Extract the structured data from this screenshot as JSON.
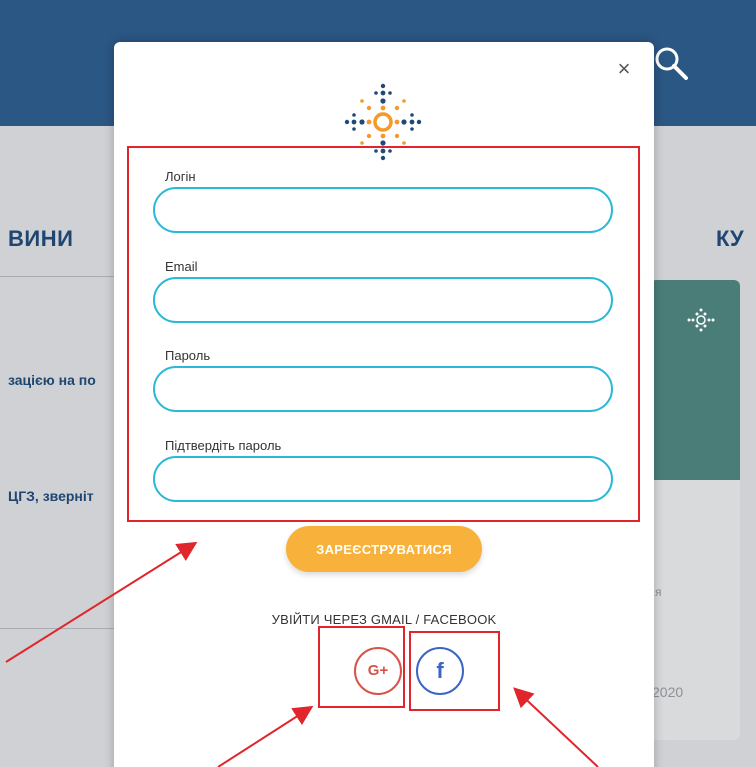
{
  "background": {
    "section_title_left": "ВИНИ",
    "section_title_right": "КУ",
    "news_link_1": "зацією на по",
    "news_link_2": "ЦГЗ, зверніт",
    "card_text_fragment": "я",
    "card_year_fragment": "2020",
    "search_icon": "search-icon"
  },
  "modal": {
    "close_label": "×",
    "fields": [
      {
        "label": "Логін",
        "value": "",
        "placeholder": ""
      },
      {
        "label": "Email",
        "value": "",
        "placeholder": ""
      },
      {
        "label": "Пароль",
        "value": "",
        "placeholder": ""
      },
      {
        "label": "Підтвердіть пароль",
        "value": "",
        "placeholder": ""
      }
    ],
    "register_label": "ЗАРЕЄСТРУВАТИСЯ",
    "social_caption": "УВІЙТИ ЧЕРЕЗ GMAIL / FACEBOOK",
    "google_label": "G+",
    "facebook_label": "f"
  },
  "colors": {
    "header": "#2b5784",
    "input_border": "#2db8d8",
    "register_button": "#f8b13a",
    "google": "#d7534a",
    "facebook": "#3b66c4",
    "annotation": "#e0262c",
    "logo_blue": "#1e4a7a",
    "logo_orange": "#f39a2b"
  }
}
